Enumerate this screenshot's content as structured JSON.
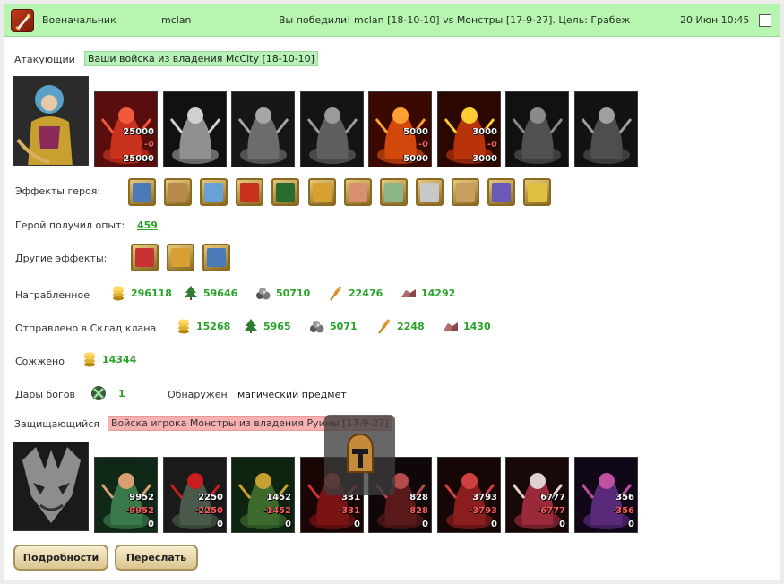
{
  "header": {
    "role": "Военачальник",
    "clan": "mclan",
    "message": "Вы победили! mclan [18-10-10] vs Монстры [17-9-27]. Цель: Грабеж",
    "datetime": "20 Июн 10:45"
  },
  "attacker": {
    "label": "Атакующий",
    "tag": "Ваши войска из владения McCity [18-10-10]",
    "units": [
      {
        "name": "dragon-red",
        "count": "25000",
        "loss": "-0",
        "after": "25000"
      },
      {
        "name": "skeleton",
        "count": "",
        "loss": "",
        "after": ""
      },
      {
        "name": "ghoul",
        "count": "",
        "loss": "",
        "after": ""
      },
      {
        "name": "gargoyle",
        "count": "",
        "loss": "",
        "after": ""
      },
      {
        "name": "fire-elemental",
        "count": "5000",
        "loss": "-0",
        "after": "5000"
      },
      {
        "name": "fire-demon",
        "count": "3000",
        "loss": "-0",
        "after": "3000"
      },
      {
        "name": "horned-knight",
        "count": "",
        "loss": "",
        "after": ""
      },
      {
        "name": "wraith",
        "count": "",
        "loss": "",
        "after": ""
      }
    ]
  },
  "hero_effects_label": "Эффекты героя:",
  "hero_effects": [
    "sword",
    "hand-sword",
    "hand-crystal",
    "xp",
    "xp-badge",
    "gold-coins",
    "horn",
    "ring",
    "scroll",
    "staff",
    "shield",
    "crown"
  ],
  "experience": {
    "label": "Герой получил опыт:",
    "value": "459"
  },
  "other_effects_label": "Другие эффекты:",
  "other_effects": [
    "heart-swords",
    "gold-coins",
    "sword"
  ],
  "looted": {
    "label": "Награбленное",
    "items": [
      {
        "icon": "gold-icon",
        "value": "296118"
      },
      {
        "icon": "tree-icon",
        "value": "59646"
      },
      {
        "icon": "stone-icon",
        "value": "50710"
      },
      {
        "icon": "wheat-icon",
        "value": "22476"
      },
      {
        "icon": "ore-icon",
        "value": "14292"
      }
    ]
  },
  "sent": {
    "label": "Отправлено в Склад клана",
    "items": [
      {
        "icon": "gold-icon",
        "value": "15268"
      },
      {
        "icon": "tree-icon",
        "value": "5965"
      },
      {
        "icon": "stone-icon",
        "value": "5071"
      },
      {
        "icon": "wheat-icon",
        "value": "2248"
      },
      {
        "icon": "ore-icon",
        "value": "1430"
      }
    ]
  },
  "burned": {
    "label": "Сожжено",
    "value": "14344"
  },
  "gifts": {
    "label": "Дары богов",
    "value": "1",
    "found_label": "Обнаружен",
    "found_link": "магический предмет"
  },
  "defender": {
    "label": "Защищающийся",
    "tag": "Войска игрока Монстры из владения Руины [17-9-27]",
    "units": [
      {
        "name": "lizard-warrior",
        "count": "9952",
        "loss": "-9952",
        "after": "0"
      },
      {
        "name": "troll",
        "count": "2250",
        "loss": "-2250",
        "after": "0"
      },
      {
        "name": "orc-shaman",
        "count": "1452",
        "loss": "-1452",
        "after": "0"
      },
      {
        "name": "red-demon",
        "count": "331",
        "loss": "-331",
        "after": "0"
      },
      {
        "name": "spider-beast",
        "count": "828",
        "loss": "-828",
        "after": "0"
      },
      {
        "name": "winged-devil",
        "count": "3793",
        "loss": "-3793",
        "after": "0"
      },
      {
        "name": "crystal-golem",
        "count": "6777",
        "loss": "-6777",
        "after": "0"
      },
      {
        "name": "hydra",
        "count": "356",
        "loss": "-356",
        "after": "0"
      }
    ]
  },
  "buttons": {
    "details": "Подробности",
    "forward": "Переслать"
  },
  "colors": {
    "header_bg": "#b8f5b0",
    "value_green": "#29a329",
    "loss_red": "#ff5a5a",
    "defender_tag_bg": "#f8b1b1"
  }
}
